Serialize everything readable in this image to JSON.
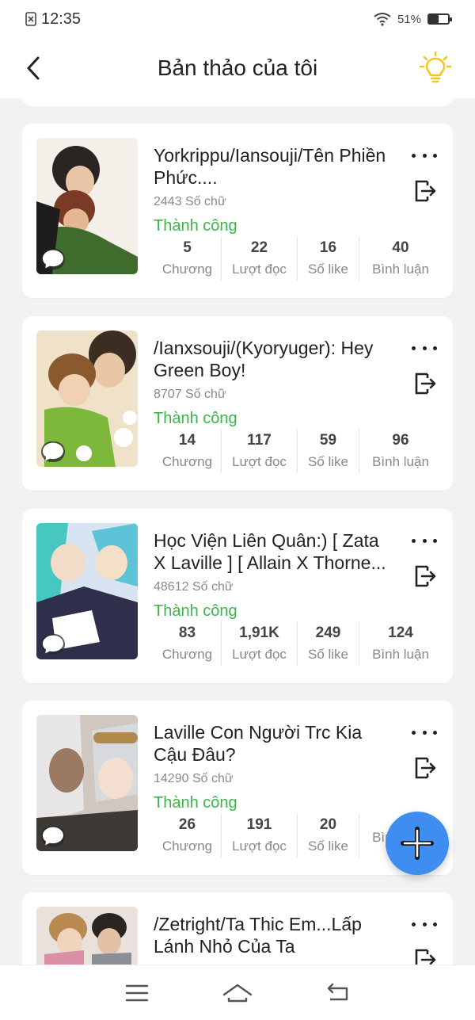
{
  "status_bar": {
    "time": "12:35",
    "battery": "51%",
    "battery_level": 0.51
  },
  "header": {
    "title": "Bản thảo của tôi"
  },
  "icons": {
    "back": "back-arrow-icon",
    "bulb": "lightbulb-icon",
    "more": "more-dots-icon",
    "export": "export-icon",
    "add": "plus-icon",
    "comment": "comment-bubble-icon"
  },
  "colors": {
    "success": "#3bb54a",
    "fab": "#3d8ef0",
    "bulb": "#f5c518"
  },
  "stat_labels": {
    "chapters": "Chương",
    "reads": "Lượt đọc",
    "likes": "Số like",
    "comments": "Bình luận"
  },
  "stories": [
    {
      "title": "Yorkrippu/Iansouji/Tên Phiền Phức....",
      "word_count": "2443 Số chữ",
      "status": "Thành công",
      "chapters": "5",
      "reads": "22",
      "likes": "16",
      "comments": "40"
    },
    {
      "title": "/Ianxsouji/(Kyoryuger): Hey Green Boy!",
      "word_count": "8707 Số chữ",
      "status": "Thành công",
      "chapters": "14",
      "reads": "117",
      "likes": "59",
      "comments": "96"
    },
    {
      "title": "Học Viện Liên Quân:) [ Zata X Laville ] [ Allain X Thorne...",
      "word_count": "48612 Số chữ",
      "status": "Thành công",
      "chapters": "83",
      "reads": "1,91K",
      "likes": "249",
      "comments": "124"
    },
    {
      "title": "Laville Con Người Trc Kia Cậu Đâu?",
      "word_count": "14290 Số chữ",
      "status": "Thành công",
      "chapters": "26",
      "reads": "191",
      "likes": "20",
      "comments": ""
    },
    {
      "title": "/Zetright/Ta Thic Em...Lấp Lánh Nhỏ Của Ta",
      "word_count": "",
      "status": "",
      "chapters": "",
      "reads": "",
      "likes": "",
      "comments": ""
    }
  ]
}
